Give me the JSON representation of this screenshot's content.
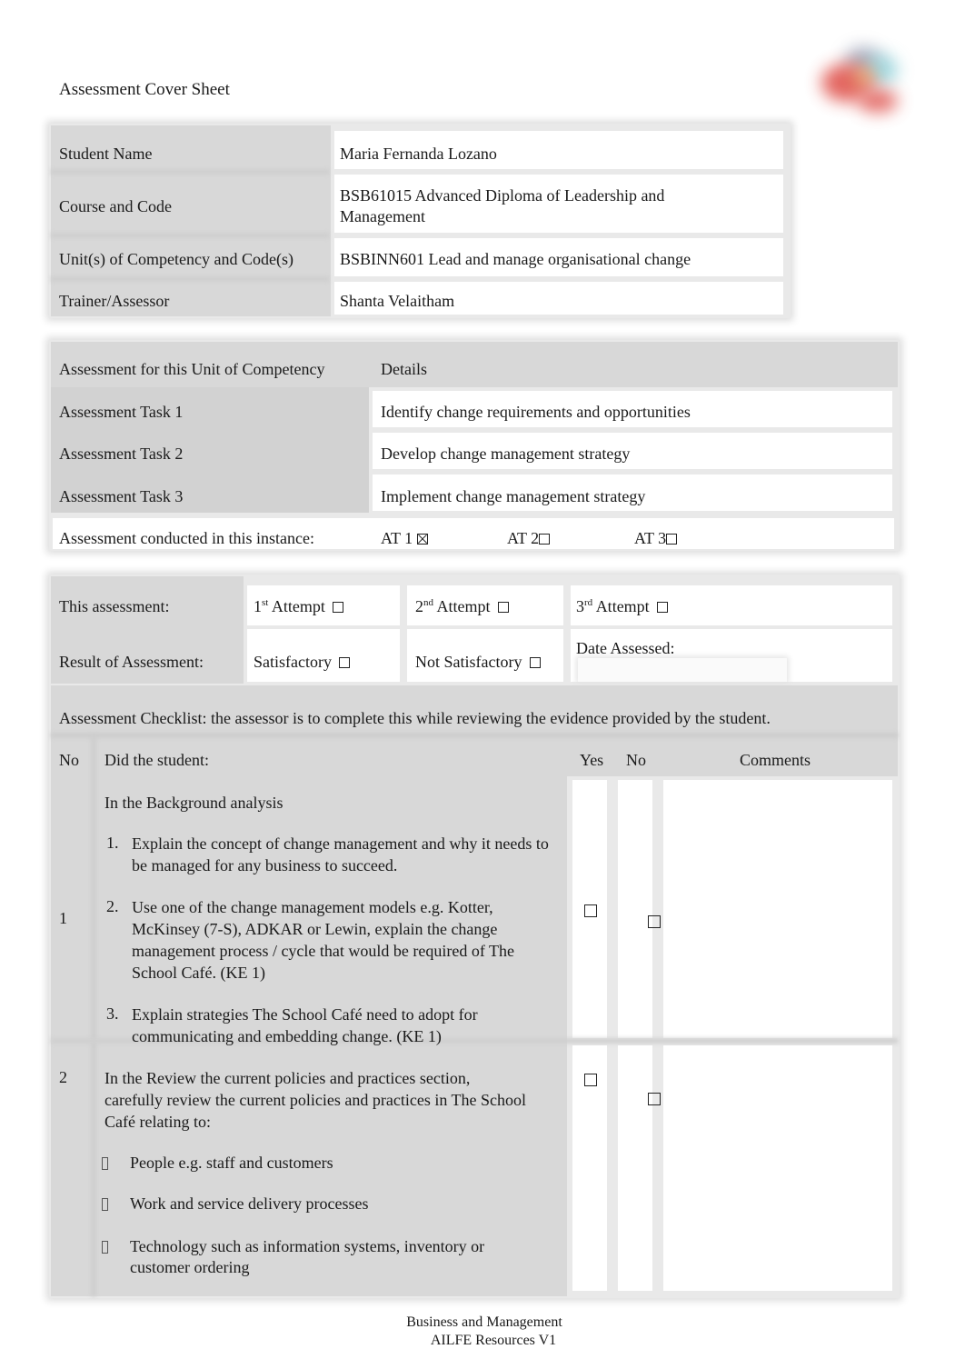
{
  "document": {
    "title": "Assessment Cover Sheet",
    "logo": "organisation-logo"
  },
  "student_info": {
    "rows": [
      {
        "label": "Student Name",
        "value": "Maria Fernanda Lozano"
      },
      {
        "label": "Course and Code",
        "value": "BSB61015 Advanced Diploma of Leadership and Management"
      },
      {
        "label": "Unit(s) of Competency and Code(s)",
        "value": "BSBINN601 Lead and manage organisational change"
      },
      {
        "label": "Trainer/Assessor",
        "value": "Shanta Velaitham"
      }
    ]
  },
  "assessment_tasks": {
    "header": {
      "col1": "Assessment for this Unit of Competency",
      "col2": "Details"
    },
    "rows": [
      {
        "label": "Assessment Task 1",
        "value": "Identify change requirements and opportunities"
      },
      {
        "label": "Assessment Task 2",
        "value": "Develop change management strategy"
      },
      {
        "label": "Assessment Task 3",
        "value": "Implement change management strategy"
      }
    ],
    "instance": {
      "label": "Assessment conducted in this instance:",
      "options": [
        {
          "label": "AT 1",
          "checked": true
        },
        {
          "label": "AT 2",
          "checked": false
        },
        {
          "label": "AT 3",
          "checked": false
        }
      ]
    }
  },
  "attempt": {
    "label": "This assessment:",
    "options": [
      {
        "num": "1",
        "suffix": "st",
        "label": "Attempt",
        "checked": false
      },
      {
        "num": "2",
        "suffix": "nd",
        "label": "Attempt",
        "checked": false
      },
      {
        "num": "3",
        "suffix": "rd",
        "label": "Attempt",
        "checked": false
      }
    ]
  },
  "result": {
    "label": "Result of Assessment:",
    "options": [
      {
        "label": "Satisfactory",
        "checked": false
      },
      {
        "label": "Not Satisfactory",
        "checked": false
      }
    ],
    "date_label": "Date Assessed:",
    "date_value": ""
  },
  "checklist": {
    "intro": "Assessment Checklist: the assessor is to complete this while reviewing the evidence provided by the student.",
    "headers": {
      "no": "No",
      "question": "Did the student:",
      "yes": "Yes",
      "no_col": "No",
      "comments": "Comments"
    },
    "items": [
      {
        "no": "1",
        "lead": "In the Background analysis",
        "subitems": [
          {
            "marker": "1.",
            "text": "Explain the concept of change management and why it needs to be managed for any business to succeed."
          },
          {
            "marker": "2.",
            "text": "Use one of the change management models e.g. Kotter, McKinsey (7-S), ADKAR or Lewin, explain the change management process / cycle that would be required of The School Café. (KE 1)"
          },
          {
            "marker": "3.",
            "text": "Explain strategies The School Café need to adopt for communicating and embedding change. (KE 1)"
          }
        ],
        "yes": false,
        "no_checked": false,
        "comments": ""
      },
      {
        "no": "2",
        "lead": "In the Review the current policies and practices section, carefully review the current policies and practices in The School Café relating to:",
        "subitems": [
          {
            "marker": "bullet",
            "text": "People e.g. staff and customers"
          },
          {
            "marker": "bullet",
            "text": "Work and service delivery processes"
          },
          {
            "marker": "bullet",
            "text": "Technology such as information systems, inventory or customer ordering"
          }
        ],
        "yes": false,
        "no_checked": false,
        "comments": ""
      }
    ]
  },
  "footer": {
    "line1": "Business and Management",
    "line2": "AILFE Resources V1"
  }
}
